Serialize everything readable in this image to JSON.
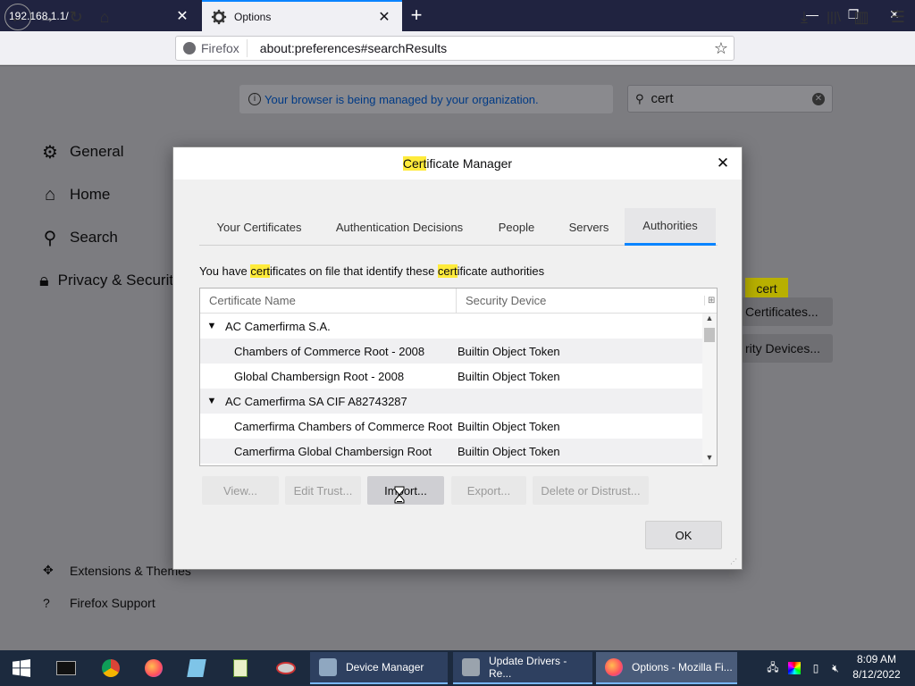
{
  "browser": {
    "tabs": [
      {
        "title": "192.168.1.1/"
      },
      {
        "title": "Options"
      }
    ],
    "identity_label": "Firefox",
    "url": "about:preferences#searchResults"
  },
  "page": {
    "policy_notice": "Your browser is being managed by your organization.",
    "search_value": "cert",
    "sidebar": [
      {
        "label": "General",
        "icon": "gear-icon"
      },
      {
        "label": "Home",
        "icon": "home-icon"
      },
      {
        "label": "Search",
        "icon": "search-icon"
      },
      {
        "label": "Privacy & Security",
        "icon": "lock-icon"
      }
    ],
    "sidebar_footer": [
      {
        "label": "Extensions & Themes",
        "icon": "puzzle-icon"
      },
      {
        "label": "Firefox Support",
        "icon": "help-icon"
      }
    ],
    "bg_highlight": "cert",
    "bg_buttons": [
      {
        "label": "Certificates..."
      },
      {
        "label": "rity Devices..."
      }
    ]
  },
  "dialog": {
    "title_prefix": "Cert",
    "title_rest": "ificate Manager",
    "tabs": [
      {
        "label": "Your Certificates"
      },
      {
        "label": "Authentication Decisions"
      },
      {
        "label": "People"
      },
      {
        "label": "Servers"
      },
      {
        "label": "Authorities"
      }
    ],
    "selected_tab": "Authorities",
    "desc": {
      "p1": "You have ",
      "h1": "cert",
      "p2": "ificates on file that identify these ",
      "h2": "cert",
      "p3": "ificate authorities"
    },
    "columns": [
      "Certificate Name",
      "Security Device"
    ],
    "rows": [
      {
        "name": "AC Camerfirma S.A.",
        "device": "",
        "group": true
      },
      {
        "name": "Chambers of Commerce Root - 2008",
        "device": "Builtin Object Token",
        "group": false
      },
      {
        "name": "Global Chambersign Root - 2008",
        "device": "Builtin Object Token",
        "group": false
      },
      {
        "name": "AC Camerfirma SA CIF A82743287",
        "device": "",
        "group": true
      },
      {
        "name": "Camerfirma Chambers of Commerce Root",
        "device": "Builtin Object Token",
        "group": false
      },
      {
        "name": "Camerfirma Global Chambersign Root",
        "device": "Builtin Object Token",
        "group": false
      }
    ],
    "buttons": {
      "view": "View...",
      "edit_trust": "Edit Trust...",
      "import": "Import...",
      "export": "Export...",
      "delete": "Delete or Distrust...",
      "ok": "OK"
    }
  },
  "taskbar": {
    "apps": [
      {
        "label": "Device Manager"
      },
      {
        "label": "Update Drivers - Re..."
      },
      {
        "label": "Options - Mozilla Fi..."
      }
    ],
    "time": "8:09 AM",
    "date": "8/12/2022"
  },
  "colors": {
    "accent": "#0a84ff",
    "highlight": "#ffeb3b",
    "titlebar": "#202340",
    "taskbar": "#1c2a3e"
  }
}
